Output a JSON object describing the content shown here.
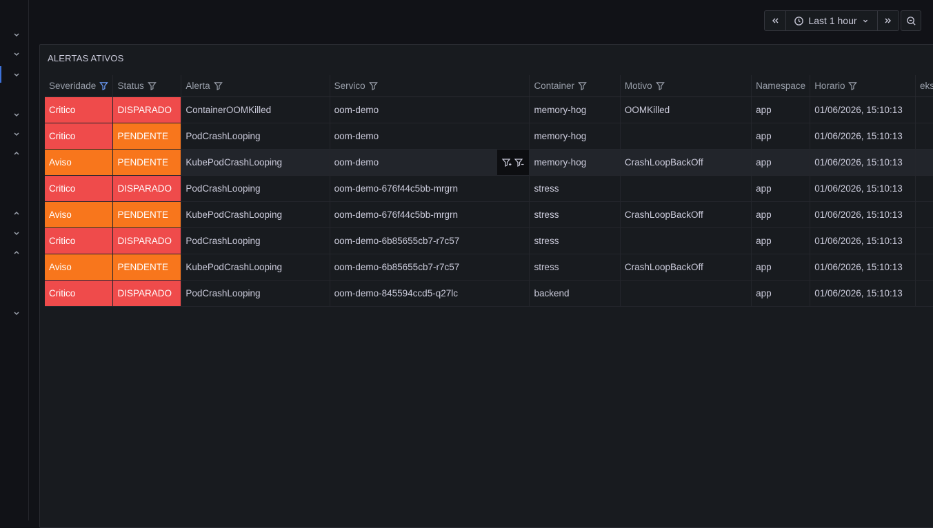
{
  "toolbar": {
    "time_range": "Last 1 hour"
  },
  "panel": {
    "title": "ALERTAS ATIVOS"
  },
  "table": {
    "columns": [
      "Severidade",
      "Status",
      "Alerta",
      "Servico",
      "Container",
      "Motivo",
      "Namespace",
      "Horario",
      "eks"
    ],
    "rows": [
      {
        "severidade": "Critico",
        "status": "DISPARADO",
        "alerta": "ContainerOOMKilled",
        "servico": "oom-demo",
        "container": "memory-hog",
        "motivo": "OOMKilled",
        "namespace": "app",
        "horario": "01/06/2026, 15:10:13",
        "eks": ""
      },
      {
        "severidade": "Critico",
        "status": "PENDENTE",
        "alerta": "PodCrashLooping",
        "servico": "oom-demo",
        "container": "memory-hog",
        "motivo": "",
        "namespace": "app",
        "horario": "01/06/2026, 15:10:13",
        "eks": ""
      },
      {
        "severidade": "Aviso",
        "status": "PENDENTE",
        "alerta": "KubePodCrashLooping",
        "servico": "oom-demo",
        "container": "memory-hog",
        "motivo": "CrashLoopBackOff",
        "namespace": "app",
        "horario": "01/06/2026, 15:10:13",
        "eks": ""
      },
      {
        "severidade": "Critico",
        "status": "DISPARADO",
        "alerta": "PodCrashLooping",
        "servico": "oom-demo-676f44c5bb-mrgrn",
        "container": "stress",
        "motivo": "",
        "namespace": "app",
        "horario": "01/06/2026, 15:10:13",
        "eks": ""
      },
      {
        "severidade": "Aviso",
        "status": "PENDENTE",
        "alerta": "KubePodCrashLooping",
        "servico": "oom-demo-676f44c5bb-mrgrn",
        "container": "stress",
        "motivo": "CrashLoopBackOff",
        "namespace": "app",
        "horario": "01/06/2026, 15:10:13",
        "eks": ""
      },
      {
        "severidade": "Critico",
        "status": "DISPARADO",
        "alerta": "PodCrashLooping",
        "servico": "oom-demo-6b85655cb7-r7c57",
        "container": "stress",
        "motivo": "",
        "namespace": "app",
        "horario": "01/06/2026, 15:10:13",
        "eks": ""
      },
      {
        "severidade": "Aviso",
        "status": "PENDENTE",
        "alerta": "KubePodCrashLooping",
        "servico": "oom-demo-6b85655cb7-r7c57",
        "container": "stress",
        "motivo": "CrashLoopBackOff",
        "namespace": "app",
        "horario": "01/06/2026, 15:10:13",
        "eks": ""
      },
      {
        "severidade": "Critico",
        "status": "DISPARADO",
        "alerta": "PodCrashLooping",
        "servico": "oom-demo-845594ccd5-q27lc",
        "container": "backend",
        "motivo": "",
        "namespace": "app",
        "horario": "01/06/2026, 15:10:13",
        "eks": ""
      }
    ]
  },
  "colors": {
    "critical": "#ef4b4b",
    "warning": "#f8761c",
    "filter_active": "#6e9fff"
  }
}
